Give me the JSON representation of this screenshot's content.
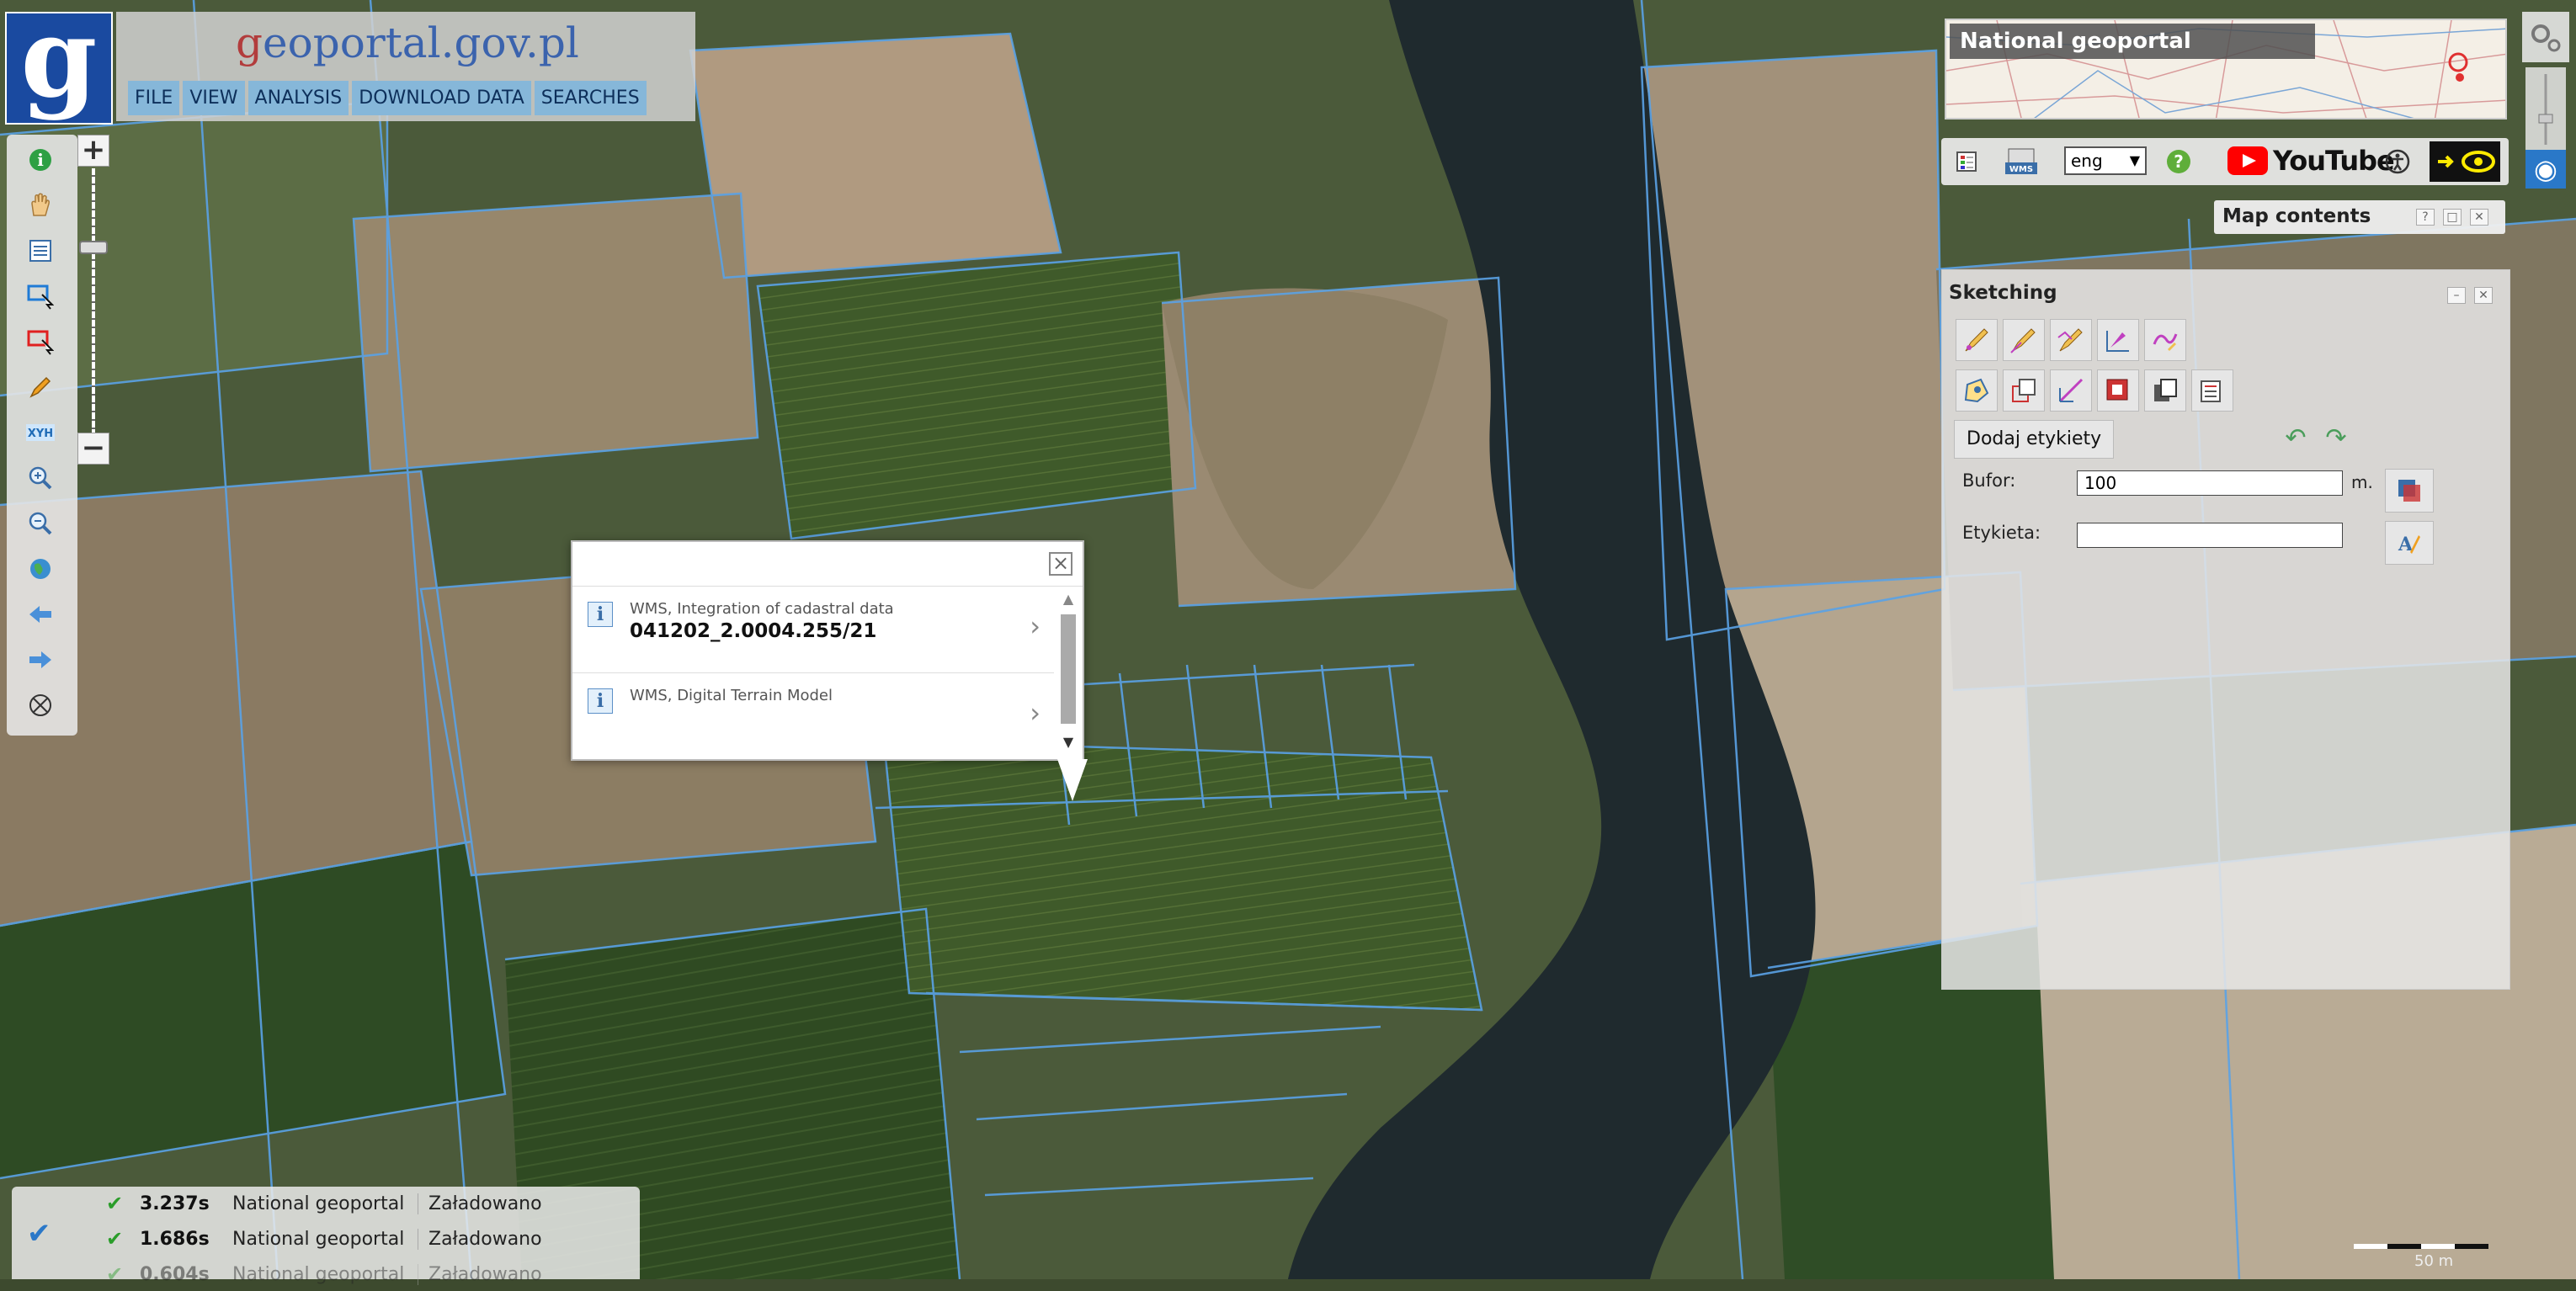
{
  "app": {
    "site_prefix": "g",
    "site_mid": "eoportal",
    "site_suffix": ".gov.pl",
    "logo_letter": "g"
  },
  "menu": [
    "FILE",
    "VIEW",
    "ANALYSIS",
    "DOWNLOAD DATA",
    "SEARCHES"
  ],
  "left_tools": [
    {
      "icon": "info-icon"
    },
    {
      "icon": "hand-pan-icon"
    },
    {
      "icon": "layer-list-icon"
    },
    {
      "icon": "select-blue-icon"
    },
    {
      "icon": "select-red-icon"
    },
    {
      "icon": "pencil-icon"
    },
    {
      "icon": "xyh-icon",
      "label": "XYH"
    },
    {
      "icon": "zoom-in-icon"
    },
    {
      "icon": "zoom-out-icon"
    },
    {
      "icon": "globe-icon"
    },
    {
      "icon": "back-arrow-icon"
    },
    {
      "icon": "forward-arrow-icon"
    },
    {
      "icon": "crosshair-icon"
    }
  ],
  "zoom": {
    "plus": "+",
    "minus": "−"
  },
  "popup": {
    "close": "×",
    "items": [
      {
        "source": "WMS, Integration of cadastral data",
        "value": "041202_2.0004.255/21",
        "info": "i"
      },
      {
        "source": "WMS, Digital Terrain Model",
        "value": "",
        "info": "i"
      }
    ]
  },
  "overview": {
    "title": "National geoportal"
  },
  "iconbar": {
    "language": "eng",
    "help": "?",
    "youtube": "YouTube"
  },
  "map_contents": {
    "title": "Map contents",
    "help": "?"
  },
  "sketching": {
    "title": "Sketching",
    "add_labels": "Dodaj etykiety",
    "buffer_label": "Bufor:",
    "buffer_value": "100",
    "buffer_unit": "m.",
    "label_label": "Etykieta:",
    "label_value": ""
  },
  "status": {
    "rows": [
      {
        "time": "3.237s",
        "source": "National geoportal",
        "state": "Załadowano"
      },
      {
        "time": "1.686s",
        "source": "National geoportal",
        "state": "Załadowano"
      },
      {
        "time": "0.604s",
        "source": "National geoportal",
        "state": "Załadowano"
      }
    ]
  },
  "scale": {
    "label": "50 m"
  },
  "colors": {
    "parcel_lines": "#5aa2e6",
    "river": "#1f2a2e",
    "menu_bg": "#86b7d9",
    "logo_bg": "#1a4aa0"
  }
}
